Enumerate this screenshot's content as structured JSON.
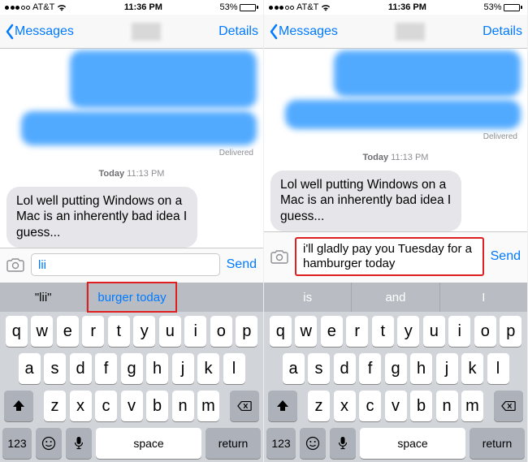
{
  "status": {
    "carrier": "AT&T",
    "time": "11:36 PM",
    "battery_pct": "53%",
    "battery_fill": 53
  },
  "nav": {
    "back": "Messages",
    "details": "Details"
  },
  "conv": {
    "delivered": "Delivered",
    "timestamp_day": "Today",
    "timestamp_time": "11:13 PM",
    "incoming": "Lol well putting Windows on a Mac is an inherently bad idea I guess..."
  },
  "left": {
    "input": "lii",
    "send": "Send",
    "pred": [
      "\"lii\"",
      "burger today",
      ""
    ]
  },
  "right": {
    "input": "i'll gladly pay you Tuesday for a hamburger today",
    "send": "Send",
    "pred": [
      "is",
      "and",
      "I"
    ]
  },
  "kbd": {
    "r1": [
      "q",
      "w",
      "e",
      "r",
      "t",
      "y",
      "u",
      "i",
      "o",
      "p"
    ],
    "r2": [
      "a",
      "s",
      "d",
      "f",
      "g",
      "h",
      "j",
      "k",
      "l"
    ],
    "r3": [
      "z",
      "x",
      "c",
      "v",
      "b",
      "n",
      "m"
    ],
    "num": "123",
    "space": "space",
    "return": "return"
  }
}
